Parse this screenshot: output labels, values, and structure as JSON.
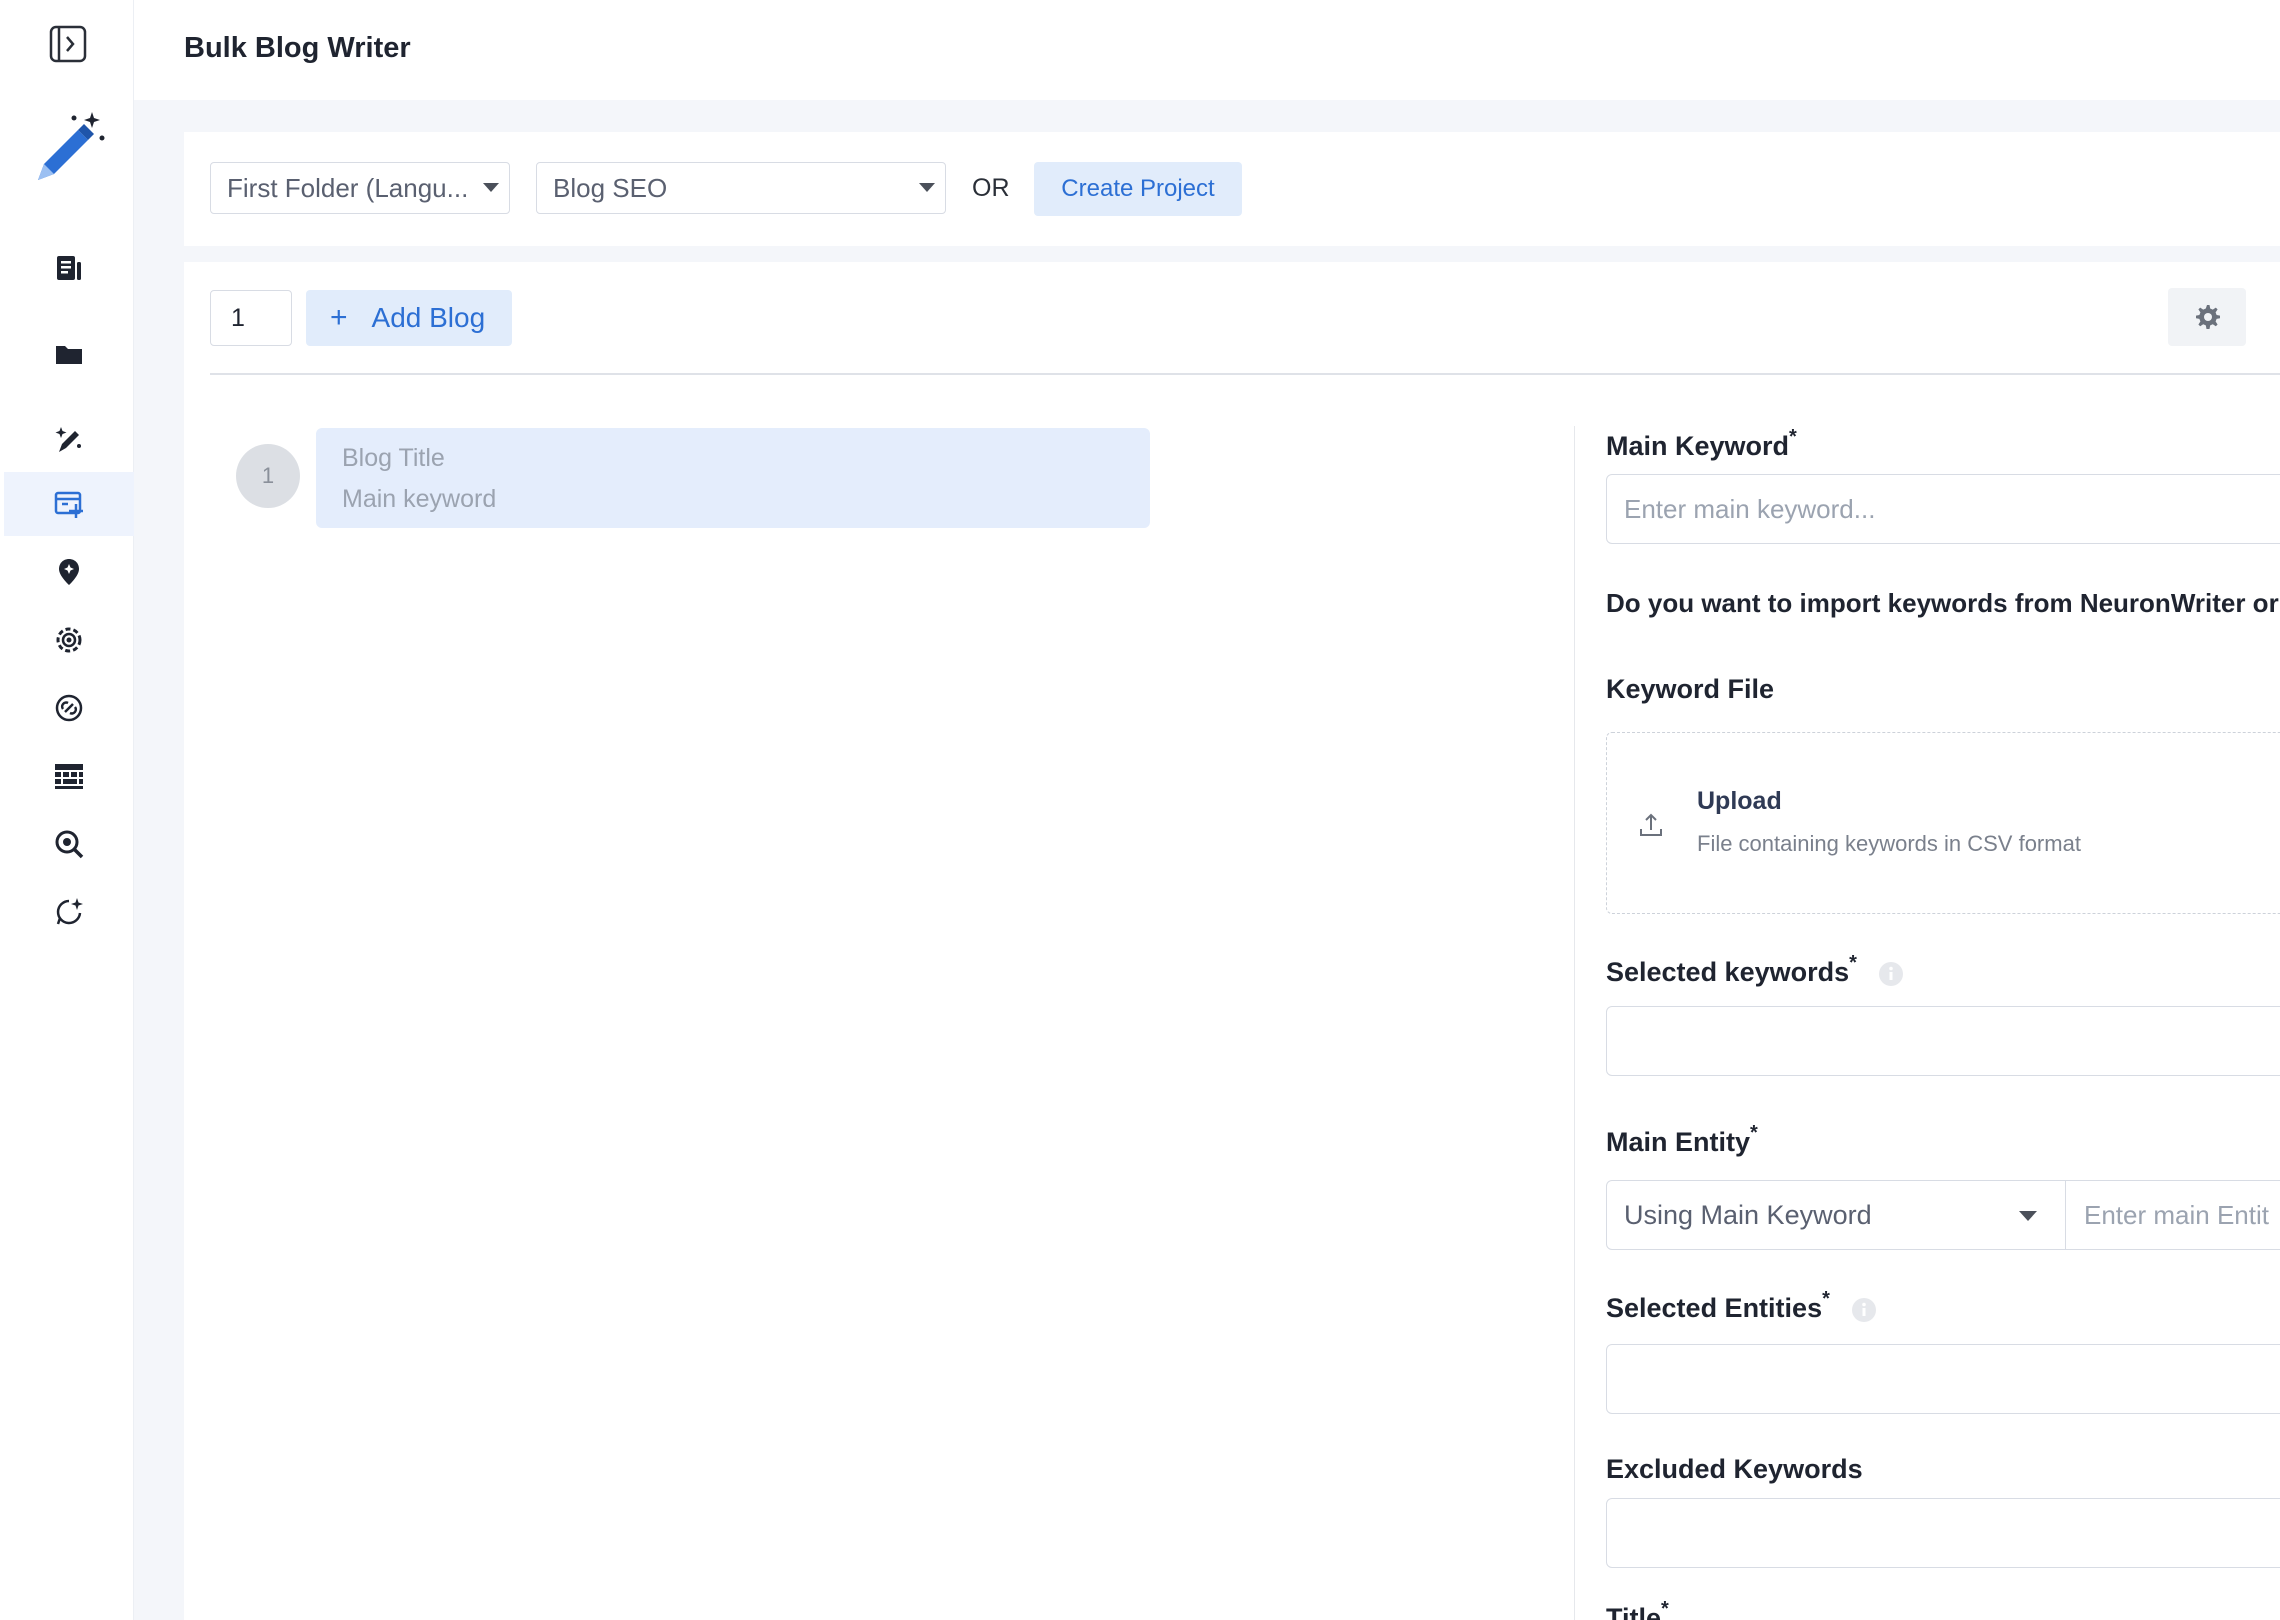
{
  "header": {
    "title": "Bulk Blog Writer"
  },
  "sidebar": {
    "items": [
      {
        "icon": "document-icon"
      },
      {
        "icon": "folder-icon"
      },
      {
        "icon": "magic-pen-icon"
      },
      {
        "icon": "calendar-add-icon",
        "active": true
      },
      {
        "icon": "location-pin-icon"
      },
      {
        "icon": "gear-cog-icon"
      },
      {
        "icon": "link-icon"
      },
      {
        "icon": "keyboard-icon"
      },
      {
        "icon": "search-icon"
      },
      {
        "icon": "chat-spark-icon"
      }
    ]
  },
  "project": {
    "folder_select": "First Folder (Langu...",
    "project_select": "Blog SEO",
    "or_label": "OR",
    "create_button": "Create Project"
  },
  "blogs": {
    "count_value": "1",
    "add_button": "Add Blog",
    "items": [
      {
        "number": "1",
        "title_placeholder": "Blog Title",
        "keyword_placeholder": "Main keyword"
      }
    ]
  },
  "form": {
    "main_keyword": {
      "label": "Main Keyword",
      "required": "*",
      "placeholder": "Enter main keyword..."
    },
    "import_question": "Do you want to import keywords from NeuronWriter or",
    "keyword_file": {
      "label": "Keyword File",
      "upload_title": "Upload",
      "upload_subtitle": "File containing keywords in CSV format"
    },
    "selected_keywords": {
      "label": "Selected keywords",
      "required": "*"
    },
    "main_entity": {
      "label": "Main Entity",
      "required": "*",
      "select_value": "Using Main Keyword",
      "input_placeholder": "Enter main Entit"
    },
    "selected_entities": {
      "label": "Selected Entities",
      "required": "*"
    },
    "excluded_keywords": {
      "label": "Excluded Keywords"
    },
    "title": {
      "label": "Title",
      "required": "*"
    }
  },
  "colors": {
    "accent": "#2c6fd4",
    "accent_bg": "#e1ecfb",
    "page_bg": "#f4f6fa"
  }
}
